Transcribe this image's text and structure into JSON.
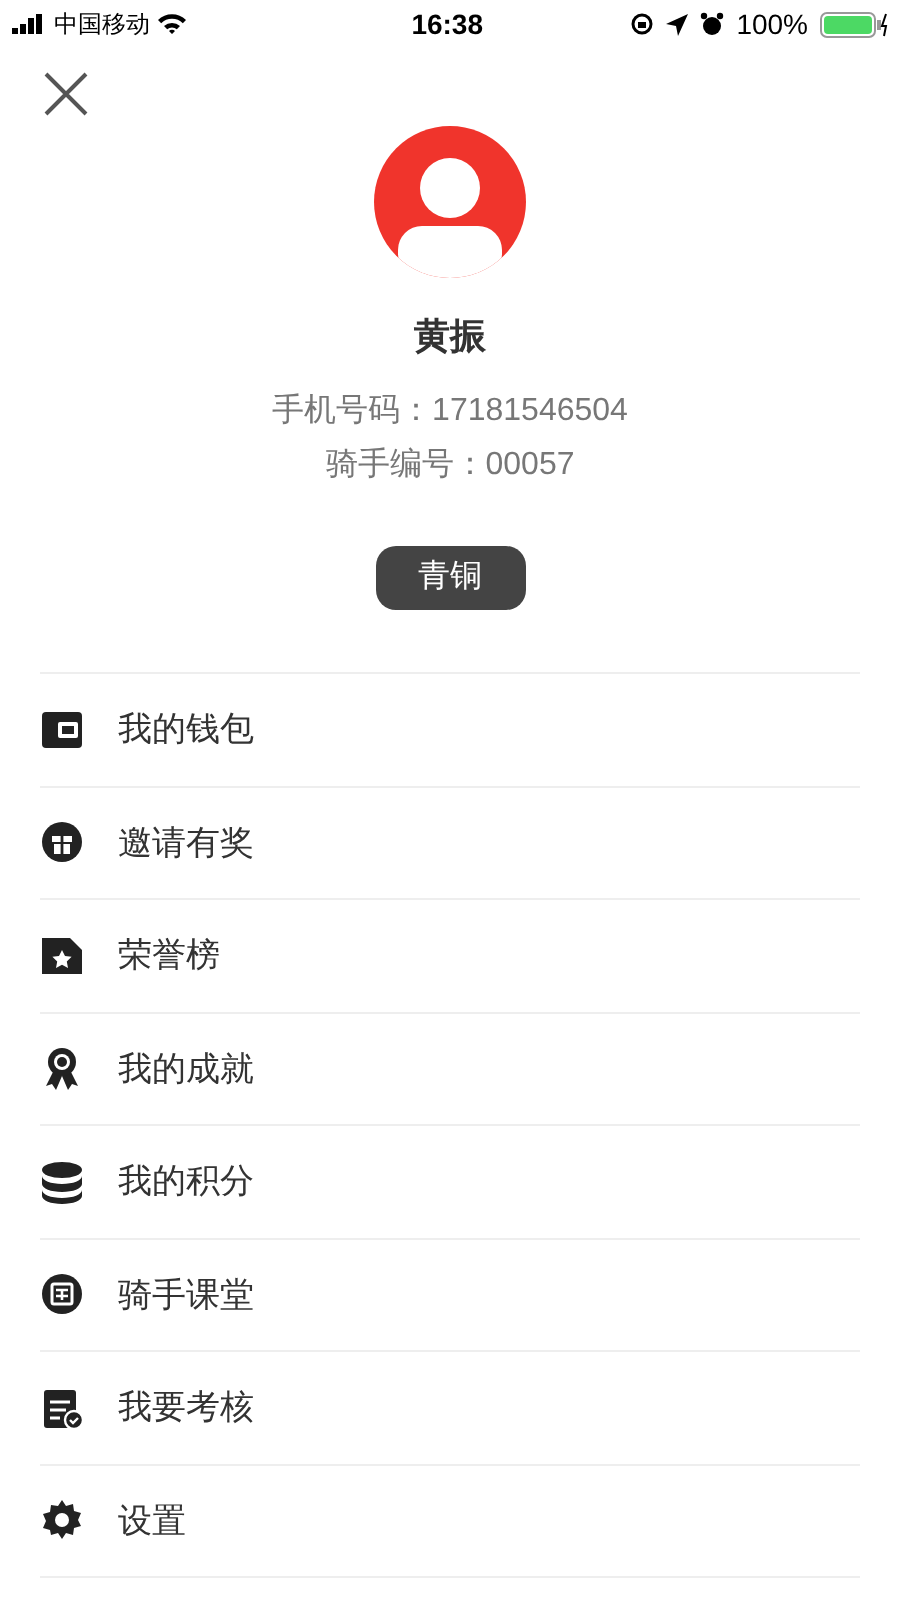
{
  "status_bar": {
    "carrier": "中国移动",
    "time": "16:38",
    "battery": "100%"
  },
  "profile": {
    "name": "黄振",
    "phone_label": "手机号码：",
    "phone": "17181546504",
    "rider_label": "骑手编号：",
    "rider_id": "00057",
    "level_badge": "青铜"
  },
  "menu": [
    {
      "kind": "wallet",
      "label": "我的钱包"
    },
    {
      "kind": "gift",
      "label": "邀请有奖"
    },
    {
      "kind": "star",
      "label": "荣誉榜"
    },
    {
      "kind": "medal",
      "label": "我的成就"
    },
    {
      "kind": "coins",
      "label": "我的积分"
    },
    {
      "kind": "course",
      "label": "骑手课堂"
    },
    {
      "kind": "exam",
      "label": "我要考核"
    },
    {
      "kind": "gear",
      "label": "设置"
    }
  ]
}
